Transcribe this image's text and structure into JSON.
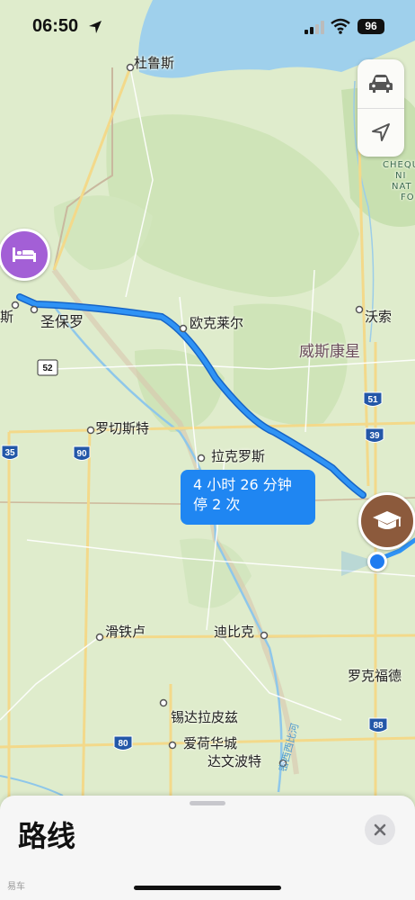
{
  "status_bar": {
    "time": "06:50",
    "battery": "96"
  },
  "cities": {
    "duluth": "杜鲁斯",
    "st_paul": "圣保罗",
    "minneapolis_partial": "斯",
    "eau_claire": "欧克莱尔",
    "wausau": "沃索",
    "rochester": "罗切斯特",
    "la_crosse": "拉克罗斯",
    "dubuque": "迪比克",
    "waterloo": "滑铁卢",
    "rockford": "罗克福德",
    "cedar_rapids": "锡达拉皮兹",
    "iowa_city": "爱荷华城",
    "davenport": "达文波特"
  },
  "region_label": "威斯康星",
  "river_label": "密西西比河",
  "park_label_lines": [
    "CHEQU",
    "NI",
    "NAT",
    "FO"
  ],
  "highway_shields": [
    "52",
    "35",
    "90",
    "51",
    "39",
    "88",
    "80"
  ],
  "route": {
    "duration": "4 小时 26 分钟",
    "stops": "停 2 次",
    "color": "#1f86f2"
  },
  "pins": {
    "start_icon": "bed-icon",
    "end_icon": "graduation-cap-icon"
  },
  "bottom_sheet": {
    "title": "路线"
  },
  "watermark": "易车"
}
